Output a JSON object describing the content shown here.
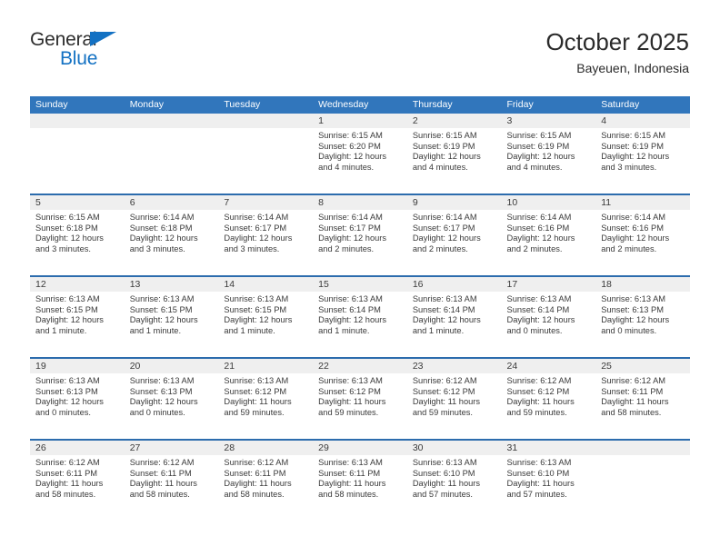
{
  "brand": {
    "name_part1": "General",
    "name_part2": "Blue",
    "flag_icon": "blue-triangle-flag-icon",
    "accent_color": "#1371c3"
  },
  "header": {
    "title": "October 2025",
    "location": "Bayeuen, Indonesia"
  },
  "calendar": {
    "header_color": "#3176bc",
    "row_divider_color": "#2c6cad",
    "date_band_color": "#efefef",
    "weekday_headers": [
      "Sunday",
      "Monday",
      "Tuesday",
      "Wednesday",
      "Thursday",
      "Friday",
      "Saturday"
    ],
    "weeks": [
      [
        {
          "day": "",
          "sunrise": "",
          "sunset": "",
          "daylight": "",
          "empty": true
        },
        {
          "day": "",
          "sunrise": "",
          "sunset": "",
          "daylight": "",
          "empty": true
        },
        {
          "day": "",
          "sunrise": "",
          "sunset": "",
          "daylight": "",
          "empty": true
        },
        {
          "day": "1",
          "sunrise": "Sunrise: 6:15 AM",
          "sunset": "Sunset: 6:20 PM",
          "daylight": "Daylight: 12 hours and 4 minutes."
        },
        {
          "day": "2",
          "sunrise": "Sunrise: 6:15 AM",
          "sunset": "Sunset: 6:19 PM",
          "daylight": "Daylight: 12 hours and 4 minutes."
        },
        {
          "day": "3",
          "sunrise": "Sunrise: 6:15 AM",
          "sunset": "Sunset: 6:19 PM",
          "daylight": "Daylight: 12 hours and 4 minutes."
        },
        {
          "day": "4",
          "sunrise": "Sunrise: 6:15 AM",
          "sunset": "Sunset: 6:19 PM",
          "daylight": "Daylight: 12 hours and 3 minutes."
        }
      ],
      [
        {
          "day": "5",
          "sunrise": "Sunrise: 6:15 AM",
          "sunset": "Sunset: 6:18 PM",
          "daylight": "Daylight: 12 hours and 3 minutes."
        },
        {
          "day": "6",
          "sunrise": "Sunrise: 6:14 AM",
          "sunset": "Sunset: 6:18 PM",
          "daylight": "Daylight: 12 hours and 3 minutes."
        },
        {
          "day": "7",
          "sunrise": "Sunrise: 6:14 AM",
          "sunset": "Sunset: 6:17 PM",
          "daylight": "Daylight: 12 hours and 3 minutes."
        },
        {
          "day": "8",
          "sunrise": "Sunrise: 6:14 AM",
          "sunset": "Sunset: 6:17 PM",
          "daylight": "Daylight: 12 hours and 2 minutes."
        },
        {
          "day": "9",
          "sunrise": "Sunrise: 6:14 AM",
          "sunset": "Sunset: 6:17 PM",
          "daylight": "Daylight: 12 hours and 2 minutes."
        },
        {
          "day": "10",
          "sunrise": "Sunrise: 6:14 AM",
          "sunset": "Sunset: 6:16 PM",
          "daylight": "Daylight: 12 hours and 2 minutes."
        },
        {
          "day": "11",
          "sunrise": "Sunrise: 6:14 AM",
          "sunset": "Sunset: 6:16 PM",
          "daylight": "Daylight: 12 hours and 2 minutes."
        }
      ],
      [
        {
          "day": "12",
          "sunrise": "Sunrise: 6:13 AM",
          "sunset": "Sunset: 6:15 PM",
          "daylight": "Daylight: 12 hours and 1 minute."
        },
        {
          "day": "13",
          "sunrise": "Sunrise: 6:13 AM",
          "sunset": "Sunset: 6:15 PM",
          "daylight": "Daylight: 12 hours and 1 minute."
        },
        {
          "day": "14",
          "sunrise": "Sunrise: 6:13 AM",
          "sunset": "Sunset: 6:15 PM",
          "daylight": "Daylight: 12 hours and 1 minute."
        },
        {
          "day": "15",
          "sunrise": "Sunrise: 6:13 AM",
          "sunset": "Sunset: 6:14 PM",
          "daylight": "Daylight: 12 hours and 1 minute."
        },
        {
          "day": "16",
          "sunrise": "Sunrise: 6:13 AM",
          "sunset": "Sunset: 6:14 PM",
          "daylight": "Daylight: 12 hours and 1 minute."
        },
        {
          "day": "17",
          "sunrise": "Sunrise: 6:13 AM",
          "sunset": "Sunset: 6:14 PM",
          "daylight": "Daylight: 12 hours and 0 minutes."
        },
        {
          "day": "18",
          "sunrise": "Sunrise: 6:13 AM",
          "sunset": "Sunset: 6:13 PM",
          "daylight": "Daylight: 12 hours and 0 minutes."
        }
      ],
      [
        {
          "day": "19",
          "sunrise": "Sunrise: 6:13 AM",
          "sunset": "Sunset: 6:13 PM",
          "daylight": "Daylight: 12 hours and 0 minutes."
        },
        {
          "day": "20",
          "sunrise": "Sunrise: 6:13 AM",
          "sunset": "Sunset: 6:13 PM",
          "daylight": "Daylight: 12 hours and 0 minutes."
        },
        {
          "day": "21",
          "sunrise": "Sunrise: 6:13 AM",
          "sunset": "Sunset: 6:12 PM",
          "daylight": "Daylight: 11 hours and 59 minutes."
        },
        {
          "day": "22",
          "sunrise": "Sunrise: 6:13 AM",
          "sunset": "Sunset: 6:12 PM",
          "daylight": "Daylight: 11 hours and 59 minutes."
        },
        {
          "day": "23",
          "sunrise": "Sunrise: 6:12 AM",
          "sunset": "Sunset: 6:12 PM",
          "daylight": "Daylight: 11 hours and 59 minutes."
        },
        {
          "day": "24",
          "sunrise": "Sunrise: 6:12 AM",
          "sunset": "Sunset: 6:12 PM",
          "daylight": "Daylight: 11 hours and 59 minutes."
        },
        {
          "day": "25",
          "sunrise": "Sunrise: 6:12 AM",
          "sunset": "Sunset: 6:11 PM",
          "daylight": "Daylight: 11 hours and 58 minutes."
        }
      ],
      [
        {
          "day": "26",
          "sunrise": "Sunrise: 6:12 AM",
          "sunset": "Sunset: 6:11 PM",
          "daylight": "Daylight: 11 hours and 58 minutes."
        },
        {
          "day": "27",
          "sunrise": "Sunrise: 6:12 AM",
          "sunset": "Sunset: 6:11 PM",
          "daylight": "Daylight: 11 hours and 58 minutes."
        },
        {
          "day": "28",
          "sunrise": "Sunrise: 6:12 AM",
          "sunset": "Sunset: 6:11 PM",
          "daylight": "Daylight: 11 hours and 58 minutes."
        },
        {
          "day": "29",
          "sunrise": "Sunrise: 6:13 AM",
          "sunset": "Sunset: 6:11 PM",
          "daylight": "Daylight: 11 hours and 58 minutes."
        },
        {
          "day": "30",
          "sunrise": "Sunrise: 6:13 AM",
          "sunset": "Sunset: 6:10 PM",
          "daylight": "Daylight: 11 hours and 57 minutes."
        },
        {
          "day": "31",
          "sunrise": "Sunrise: 6:13 AM",
          "sunset": "Sunset: 6:10 PM",
          "daylight": "Daylight: 11 hours and 57 minutes."
        },
        {
          "day": "",
          "sunrise": "",
          "sunset": "",
          "daylight": "",
          "empty": true
        }
      ]
    ]
  }
}
